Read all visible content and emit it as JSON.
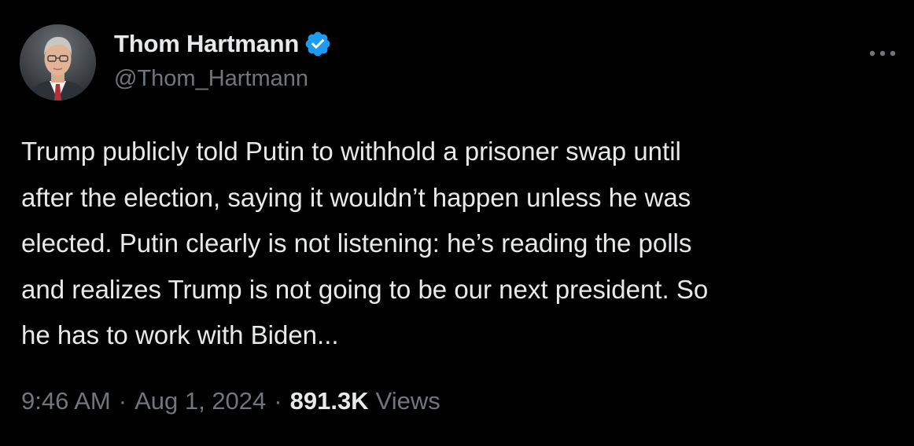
{
  "author": {
    "display_name": "Thom Hartmann",
    "handle": "@Thom_Hartmann",
    "verified": true,
    "avatar_icon": "profile-photo",
    "verified_icon": "verified-badge-icon"
  },
  "tweet": {
    "lines": [
      "Trump publicly told Putin to withhold a prisoner swap until",
      "after the election, saying it wouldn’t happen unless he was",
      "elected. Putin clearly is not listening: he’s reading the polls",
      "and realizes Trump is not going to be our next president. So",
      "he has to work with Biden..."
    ]
  },
  "meta": {
    "time": "9:46 AM",
    "separator": "·",
    "date": "Aug 1, 2024",
    "views_count": "891.3K",
    "views_label": "Views"
  },
  "menu": {
    "icon": "more-options-icon"
  },
  "colors": {
    "background": "#000000",
    "primary_text": "#e7e9ea",
    "secondary_text": "#71767b",
    "verified_badge": "#1d9bf0"
  }
}
